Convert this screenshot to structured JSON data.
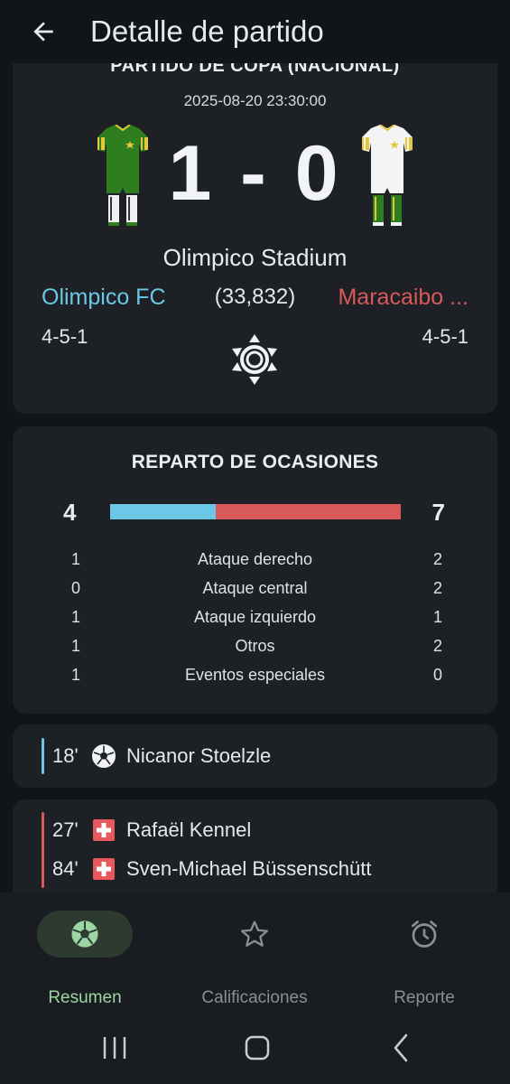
{
  "app_bar": {
    "title": "Detalle de partido",
    "back_icon": "arrow-left-icon"
  },
  "match": {
    "competition": "PARTIDO DE COPA (NACIONAL)",
    "datetime": "2025-08-20 23:30:00",
    "score": "1 - 0",
    "stadium": "Olimpico Stadium",
    "home_team": "Olimpico FC",
    "away_team": "Maracaibo ...",
    "attendance": "(33,832)",
    "home_formation": "4-5-1",
    "away_formation": "4-5-1",
    "weather_icon": "sunny-icon",
    "home_color": "#6cc6e6",
    "away_color": "#d9585a"
  },
  "chances": {
    "title": "REPARTO DE OCASIONES",
    "home_total": "4",
    "away_total": "7",
    "home_share": 0.364,
    "rows": [
      {
        "home": "1",
        "label": "Ataque derecho",
        "away": "2"
      },
      {
        "home": "0",
        "label": "Ataque central",
        "away": "2"
      },
      {
        "home": "1",
        "label": "Ataque izquierdo",
        "away": "1"
      },
      {
        "home": "1",
        "label": "Otros",
        "away": "2"
      },
      {
        "home": "1",
        "label": "Eventos especiales",
        "away": "0"
      }
    ]
  },
  "events_home": [
    {
      "minute": "18'",
      "icon": "soccer-ball-icon",
      "player": "Nicanor Stoelzle"
    }
  ],
  "events_away": [
    {
      "minute": "27'",
      "icon": "injury-cross-icon",
      "player": "Rafaël Kennel"
    },
    {
      "minute": "84'",
      "icon": "injury-cross-icon",
      "player": "Sven-Michael Büssenschütt"
    }
  ],
  "bottom_nav": [
    {
      "label": "Resumen",
      "icon": "soccer-ball-icon",
      "active": true
    },
    {
      "label": "Calificaciones",
      "icon": "star-icon",
      "active": false
    },
    {
      "label": "Reporte",
      "icon": "alarm-clock-icon",
      "active": false
    }
  ]
}
